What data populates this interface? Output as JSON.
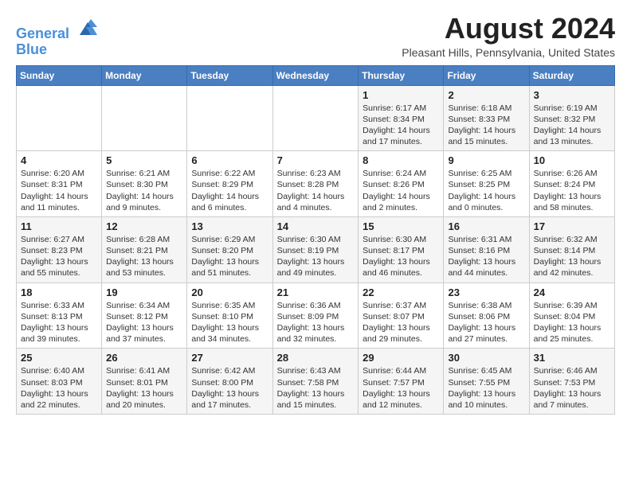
{
  "header": {
    "logo_line1": "General",
    "logo_line2": "Blue",
    "month_year": "August 2024",
    "location": "Pleasant Hills, Pennsylvania, United States"
  },
  "days_of_week": [
    "Sunday",
    "Monday",
    "Tuesday",
    "Wednesday",
    "Thursday",
    "Friday",
    "Saturday"
  ],
  "weeks": [
    [
      {
        "day": "",
        "info": ""
      },
      {
        "day": "",
        "info": ""
      },
      {
        "day": "",
        "info": ""
      },
      {
        "day": "",
        "info": ""
      },
      {
        "day": "1",
        "info": "Sunrise: 6:17 AM\nSunset: 8:34 PM\nDaylight: 14 hours\nand 17 minutes."
      },
      {
        "day": "2",
        "info": "Sunrise: 6:18 AM\nSunset: 8:33 PM\nDaylight: 14 hours\nand 15 minutes."
      },
      {
        "day": "3",
        "info": "Sunrise: 6:19 AM\nSunset: 8:32 PM\nDaylight: 14 hours\nand 13 minutes."
      }
    ],
    [
      {
        "day": "4",
        "info": "Sunrise: 6:20 AM\nSunset: 8:31 PM\nDaylight: 14 hours\nand 11 minutes."
      },
      {
        "day": "5",
        "info": "Sunrise: 6:21 AM\nSunset: 8:30 PM\nDaylight: 14 hours\nand 9 minutes."
      },
      {
        "day": "6",
        "info": "Sunrise: 6:22 AM\nSunset: 8:29 PM\nDaylight: 14 hours\nand 6 minutes."
      },
      {
        "day": "7",
        "info": "Sunrise: 6:23 AM\nSunset: 8:28 PM\nDaylight: 14 hours\nand 4 minutes."
      },
      {
        "day": "8",
        "info": "Sunrise: 6:24 AM\nSunset: 8:26 PM\nDaylight: 14 hours\nand 2 minutes."
      },
      {
        "day": "9",
        "info": "Sunrise: 6:25 AM\nSunset: 8:25 PM\nDaylight: 14 hours\nand 0 minutes."
      },
      {
        "day": "10",
        "info": "Sunrise: 6:26 AM\nSunset: 8:24 PM\nDaylight: 13 hours\nand 58 minutes."
      }
    ],
    [
      {
        "day": "11",
        "info": "Sunrise: 6:27 AM\nSunset: 8:23 PM\nDaylight: 13 hours\nand 55 minutes."
      },
      {
        "day": "12",
        "info": "Sunrise: 6:28 AM\nSunset: 8:21 PM\nDaylight: 13 hours\nand 53 minutes."
      },
      {
        "day": "13",
        "info": "Sunrise: 6:29 AM\nSunset: 8:20 PM\nDaylight: 13 hours\nand 51 minutes."
      },
      {
        "day": "14",
        "info": "Sunrise: 6:30 AM\nSunset: 8:19 PM\nDaylight: 13 hours\nand 49 minutes."
      },
      {
        "day": "15",
        "info": "Sunrise: 6:30 AM\nSunset: 8:17 PM\nDaylight: 13 hours\nand 46 minutes."
      },
      {
        "day": "16",
        "info": "Sunrise: 6:31 AM\nSunset: 8:16 PM\nDaylight: 13 hours\nand 44 minutes."
      },
      {
        "day": "17",
        "info": "Sunrise: 6:32 AM\nSunset: 8:14 PM\nDaylight: 13 hours\nand 42 minutes."
      }
    ],
    [
      {
        "day": "18",
        "info": "Sunrise: 6:33 AM\nSunset: 8:13 PM\nDaylight: 13 hours\nand 39 minutes."
      },
      {
        "day": "19",
        "info": "Sunrise: 6:34 AM\nSunset: 8:12 PM\nDaylight: 13 hours\nand 37 minutes."
      },
      {
        "day": "20",
        "info": "Sunrise: 6:35 AM\nSunset: 8:10 PM\nDaylight: 13 hours\nand 34 minutes."
      },
      {
        "day": "21",
        "info": "Sunrise: 6:36 AM\nSunset: 8:09 PM\nDaylight: 13 hours\nand 32 minutes."
      },
      {
        "day": "22",
        "info": "Sunrise: 6:37 AM\nSunset: 8:07 PM\nDaylight: 13 hours\nand 29 minutes."
      },
      {
        "day": "23",
        "info": "Sunrise: 6:38 AM\nSunset: 8:06 PM\nDaylight: 13 hours\nand 27 minutes."
      },
      {
        "day": "24",
        "info": "Sunrise: 6:39 AM\nSunset: 8:04 PM\nDaylight: 13 hours\nand 25 minutes."
      }
    ],
    [
      {
        "day": "25",
        "info": "Sunrise: 6:40 AM\nSunset: 8:03 PM\nDaylight: 13 hours\nand 22 minutes."
      },
      {
        "day": "26",
        "info": "Sunrise: 6:41 AM\nSunset: 8:01 PM\nDaylight: 13 hours\nand 20 minutes."
      },
      {
        "day": "27",
        "info": "Sunrise: 6:42 AM\nSunset: 8:00 PM\nDaylight: 13 hours\nand 17 minutes."
      },
      {
        "day": "28",
        "info": "Sunrise: 6:43 AM\nSunset: 7:58 PM\nDaylight: 13 hours\nand 15 minutes."
      },
      {
        "day": "29",
        "info": "Sunrise: 6:44 AM\nSunset: 7:57 PM\nDaylight: 13 hours\nand 12 minutes."
      },
      {
        "day": "30",
        "info": "Sunrise: 6:45 AM\nSunset: 7:55 PM\nDaylight: 13 hours\nand 10 minutes."
      },
      {
        "day": "31",
        "info": "Sunrise: 6:46 AM\nSunset: 7:53 PM\nDaylight: 13 hours\nand 7 minutes."
      }
    ]
  ]
}
